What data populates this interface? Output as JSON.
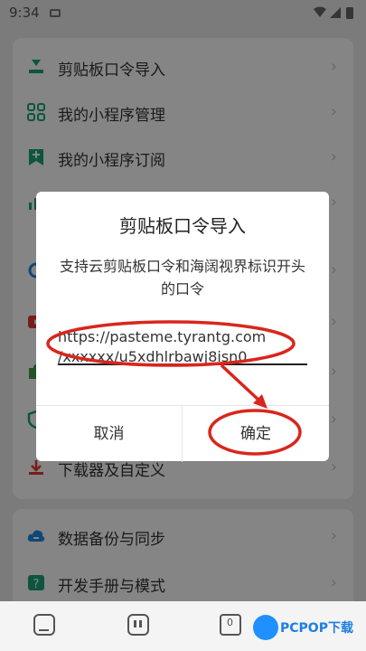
{
  "status": {
    "time": "9:34"
  },
  "menu": {
    "items": [
      {
        "label": "剪贴板口令导入",
        "icon": "download-icon"
      },
      {
        "label": "我的小程序管理",
        "icon": "apps-grid-icon"
      },
      {
        "label": "我的小程序订阅",
        "icon": "subscribe-icon"
      },
      {
        "label": "",
        "icon": "chart-icon"
      },
      {
        "label": "",
        "icon": "browser-icon"
      },
      {
        "label": "",
        "icon": "video-icon"
      },
      {
        "label": "",
        "icon": "puzzle-icon"
      },
      {
        "label": "",
        "icon": "shield-icon"
      },
      {
        "label": "下载器及自定义",
        "icon": "download-manager-icon"
      }
    ],
    "items2": [
      {
        "label": "数据备份与同步",
        "icon": "cloud-sync-icon"
      },
      {
        "label": "开发手册与模式",
        "icon": "help-icon"
      }
    ]
  },
  "dialog": {
    "title": "剪贴板口令导入",
    "message": "支持云剪贴板口令和海阔视界标识开头的口令",
    "field_line1": "https://pasteme.tyrantg.com",
    "field_line2": "/xxxxxx/u5xdhlrbawj8isn0",
    "cancel_label": "取消",
    "ok_label": "确定"
  },
  "watermark": {
    "text": "PCPOP下载"
  },
  "colors": {
    "accent_green": "#1aa37a",
    "annotation_red": "#d9261c",
    "watermark_blue": "#1e7fe0"
  }
}
